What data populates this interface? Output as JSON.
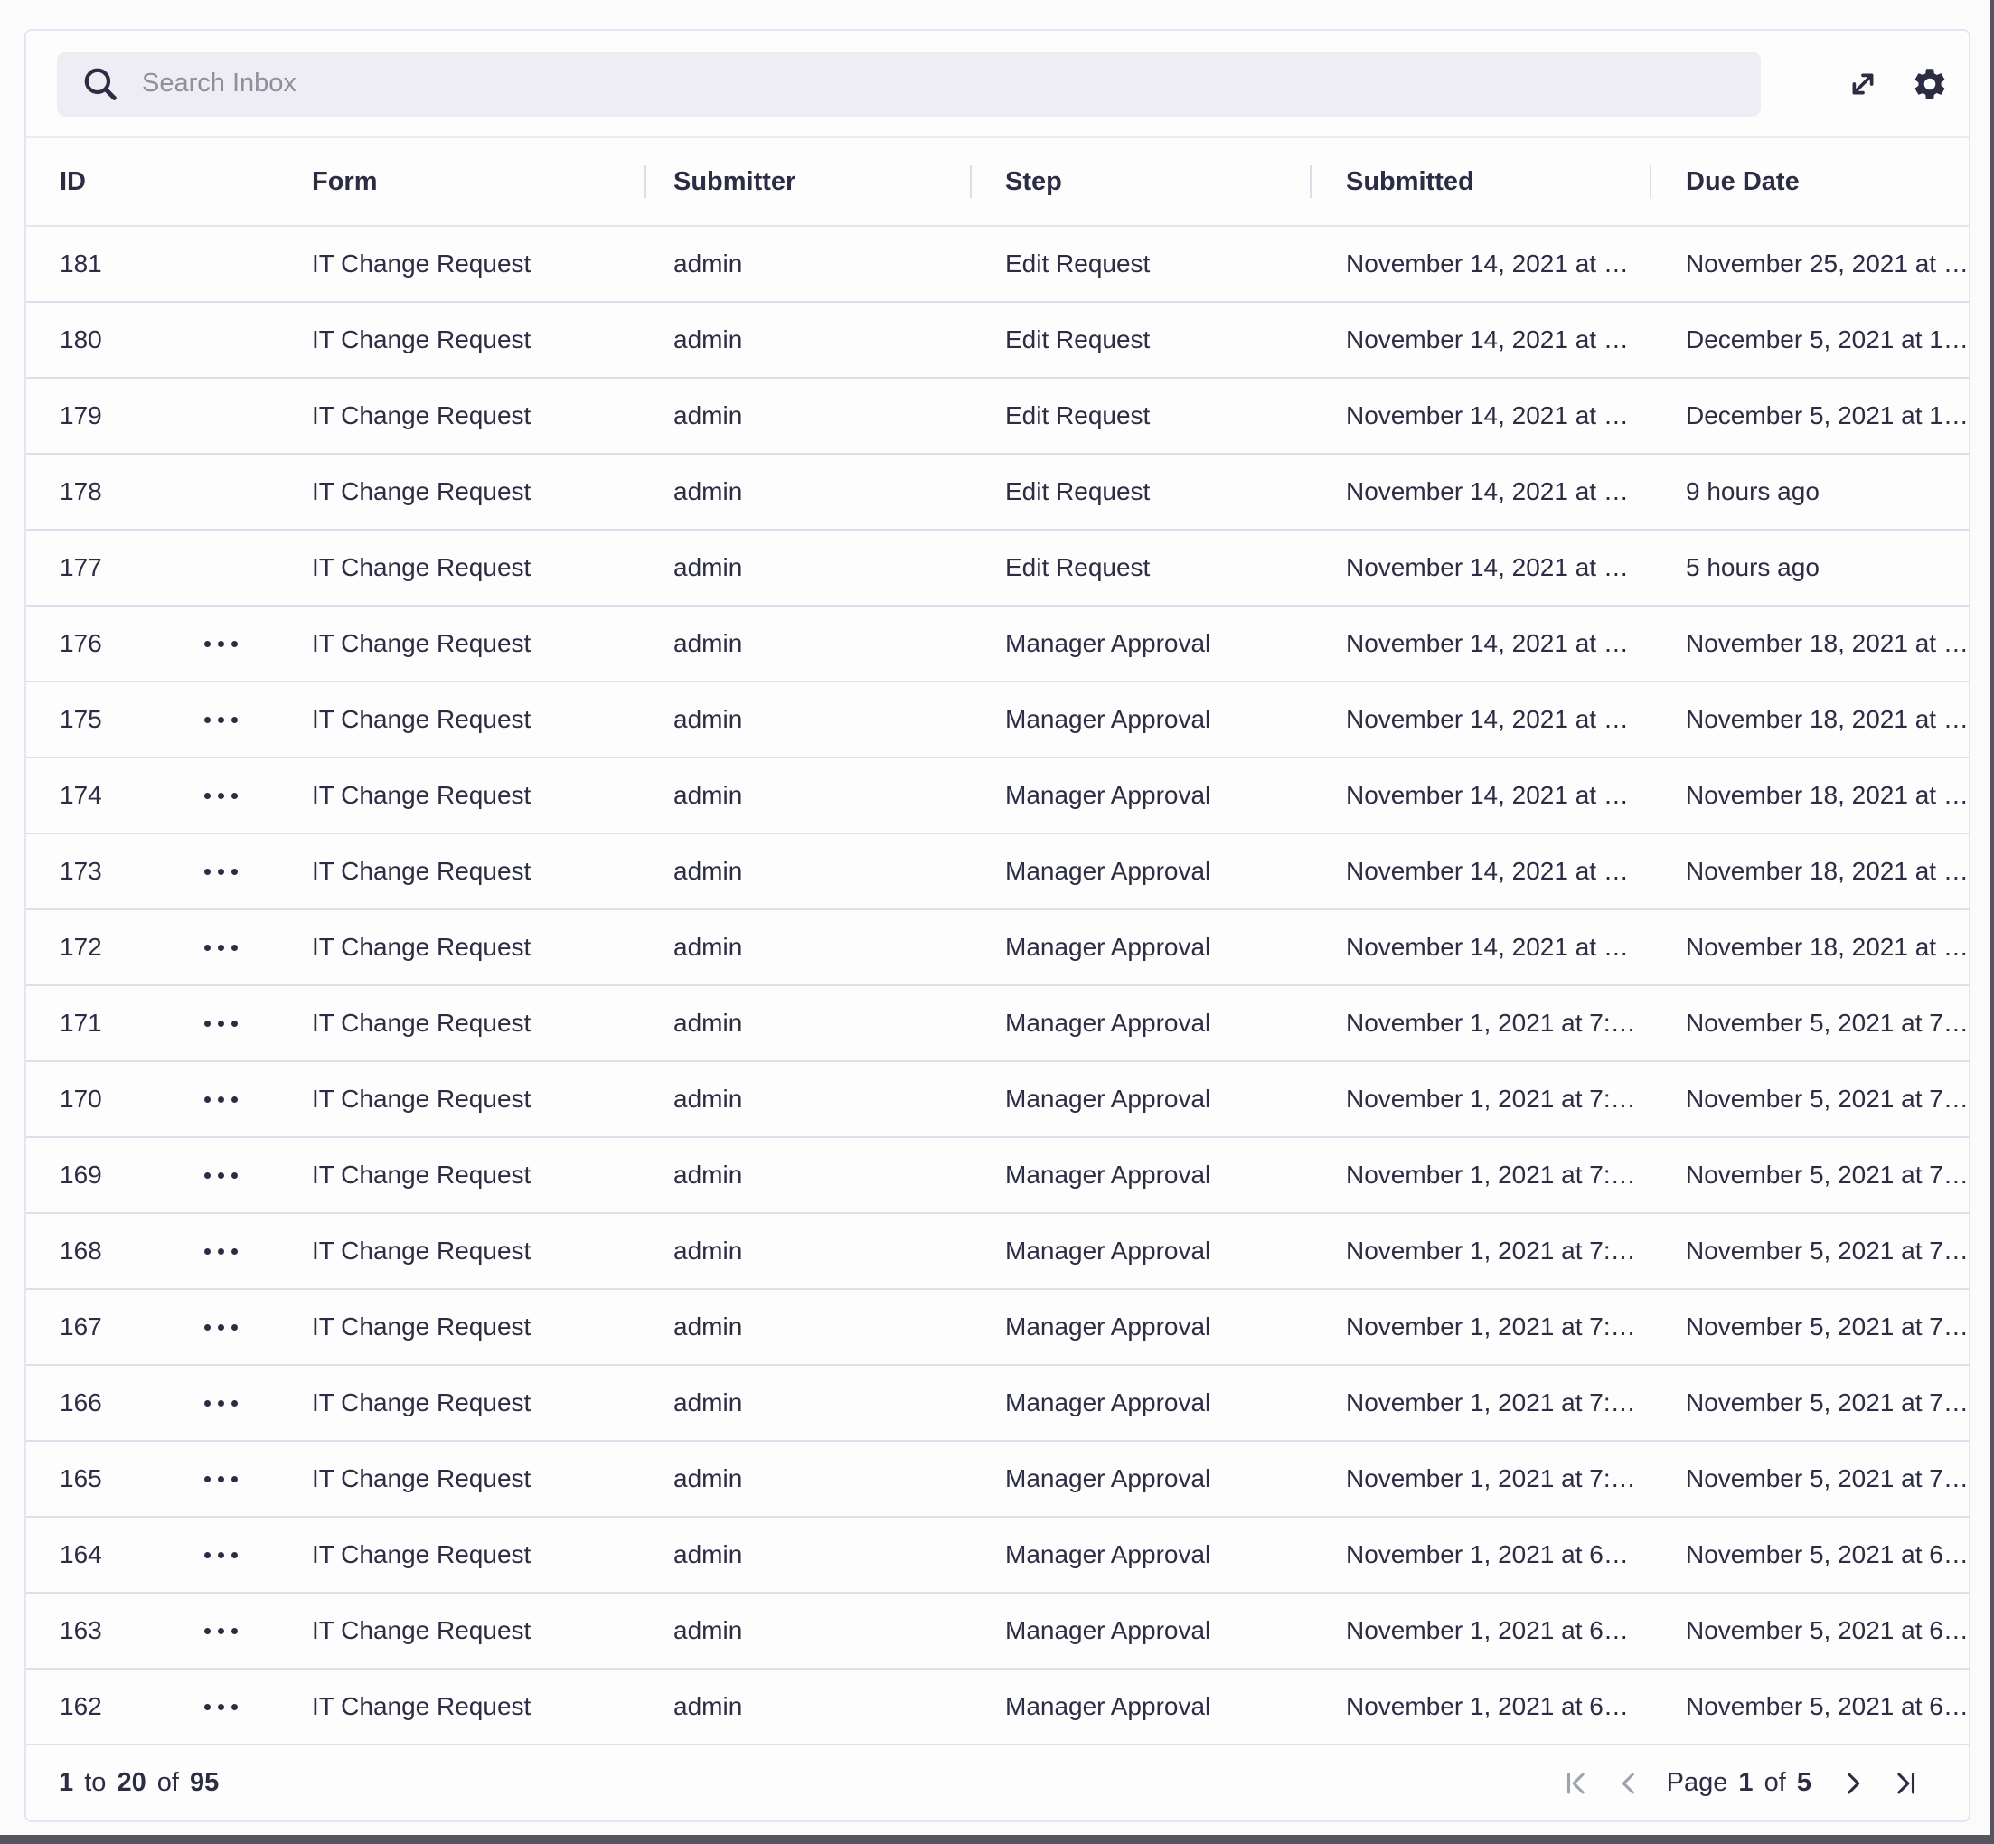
{
  "search": {
    "placeholder": "Search Inbox"
  },
  "toolbar": {
    "icons": {
      "search": "magnifier",
      "expand": "diagonal-resize-arrows",
      "settings": "gear"
    }
  },
  "colors": {
    "text": "#2c2c44",
    "placeholder": "#8e8e9d",
    "search_background": "#ededf3",
    "row_divider": "#dbe0ea",
    "card_border": "#e6e3f2",
    "disabled_control": "#9fa3ae",
    "window_edge": "#55555f"
  },
  "table": {
    "columns": [
      "ID",
      "Form",
      "Submitter",
      "Step",
      "Submitted",
      "Due Date"
    ],
    "row_menu_icon": "ellipsis-horizontal",
    "rows": [
      {
        "id": "181",
        "menu": false,
        "form": "IT Change Request",
        "submitter": "admin",
        "step": "Edit Request",
        "submitted": "November 14, 2021 at …",
        "due_date": "November 25, 2021 at …"
      },
      {
        "id": "180",
        "menu": false,
        "form": "IT Change Request",
        "submitter": "admin",
        "step": "Edit Request",
        "submitted": "November 14, 2021 at …",
        "due_date": "December 5, 2021 at 1…"
      },
      {
        "id": "179",
        "menu": false,
        "form": "IT Change Request",
        "submitter": "admin",
        "step": "Edit Request",
        "submitted": "November 14, 2021 at …",
        "due_date": "December 5, 2021 at 1…"
      },
      {
        "id": "178",
        "menu": false,
        "form": "IT Change Request",
        "submitter": "admin",
        "step": "Edit Request",
        "submitted": "November 14, 2021 at …",
        "due_date": "9 hours ago"
      },
      {
        "id": "177",
        "menu": false,
        "form": "IT Change Request",
        "submitter": "admin",
        "step": "Edit Request",
        "submitted": "November 14, 2021 at …",
        "due_date": "5 hours ago"
      },
      {
        "id": "176",
        "menu": true,
        "form": "IT Change Request",
        "submitter": "admin",
        "step": "Manager Approval",
        "submitted": "November 14, 2021 at …",
        "due_date": "November 18, 2021 at …"
      },
      {
        "id": "175",
        "menu": true,
        "form": "IT Change Request",
        "submitter": "admin",
        "step": "Manager Approval",
        "submitted": "November 14, 2021 at …",
        "due_date": "November 18, 2021 at …"
      },
      {
        "id": "174",
        "menu": true,
        "form": "IT Change Request",
        "submitter": "admin",
        "step": "Manager Approval",
        "submitted": "November 14, 2021 at …",
        "due_date": "November 18, 2021 at …"
      },
      {
        "id": "173",
        "menu": true,
        "form": "IT Change Request",
        "submitter": "admin",
        "step": "Manager Approval",
        "submitted": "November 14, 2021 at …",
        "due_date": "November 18, 2021 at …"
      },
      {
        "id": "172",
        "menu": true,
        "form": "IT Change Request",
        "submitter": "admin",
        "step": "Manager Approval",
        "submitted": "November 14, 2021 at …",
        "due_date": "November 18, 2021 at …"
      },
      {
        "id": "171",
        "menu": true,
        "form": "IT Change Request",
        "submitter": "admin",
        "step": "Manager Approval",
        "submitted": "November 1, 2021 at 7:…",
        "due_date": "November 5, 2021 at 7…"
      },
      {
        "id": "170",
        "menu": true,
        "form": "IT Change Request",
        "submitter": "admin",
        "step": "Manager Approval",
        "submitted": "November 1, 2021 at 7:…",
        "due_date": "November 5, 2021 at 7…"
      },
      {
        "id": "169",
        "menu": true,
        "form": "IT Change Request",
        "submitter": "admin",
        "step": "Manager Approval",
        "submitted": "November 1, 2021 at 7:…",
        "due_date": "November 5, 2021 at 7…"
      },
      {
        "id": "168",
        "menu": true,
        "form": "IT Change Request",
        "submitter": "admin",
        "step": "Manager Approval",
        "submitted": "November 1, 2021 at 7:…",
        "due_date": "November 5, 2021 at 7…"
      },
      {
        "id": "167",
        "menu": true,
        "form": "IT Change Request",
        "submitter": "admin",
        "step": "Manager Approval",
        "submitted": "November 1, 2021 at 7:…",
        "due_date": "November 5, 2021 at 7…"
      },
      {
        "id": "166",
        "menu": true,
        "form": "IT Change Request",
        "submitter": "admin",
        "step": "Manager Approval",
        "submitted": "November 1, 2021 at 7:…",
        "due_date": "November 5, 2021 at 7…"
      },
      {
        "id": "165",
        "menu": true,
        "form": "IT Change Request",
        "submitter": "admin",
        "step": "Manager Approval",
        "submitted": "November 1, 2021 at 7:…",
        "due_date": "November 5, 2021 at 7…"
      },
      {
        "id": "164",
        "menu": true,
        "form": "IT Change Request",
        "submitter": "admin",
        "step": "Manager Approval",
        "submitted": "November 1, 2021 at 6…",
        "due_date": "November 5, 2021 at 6…"
      },
      {
        "id": "163",
        "menu": true,
        "form": "IT Change Request",
        "submitter": "admin",
        "step": "Manager Approval",
        "submitted": "November 1, 2021 at 6…",
        "due_date": "November 5, 2021 at 6…"
      },
      {
        "id": "162",
        "menu": true,
        "form": "IT Change Request",
        "submitter": "admin",
        "step": "Manager Approval",
        "submitted": "November 1, 2021 at 6…",
        "due_date": "November 5, 2021 at 6…"
      }
    ]
  },
  "footer": {
    "range": {
      "from": "1",
      "to_label": "to",
      "to": "20",
      "of_label": "of",
      "total": "95"
    },
    "pagination": {
      "page_label": "Page",
      "current": "1",
      "of_label": "of",
      "total": "5",
      "icons": {
        "first": "bar-chevron-left-icon",
        "prev": "chevron-left-icon",
        "next": "chevron-right-icon",
        "last": "chevron-right-bar-icon"
      },
      "first_enabled": false,
      "prev_enabled": false,
      "next_enabled": true,
      "last_enabled": true
    }
  }
}
